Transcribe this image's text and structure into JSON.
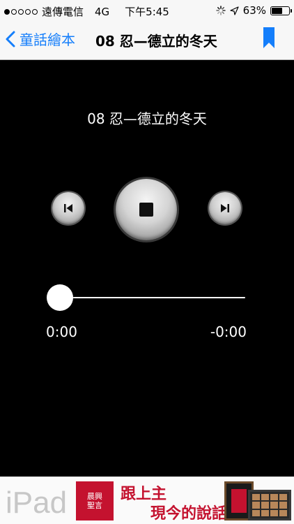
{
  "status_bar": {
    "carrier": "遠傳電信",
    "network": "4G",
    "time": "下午5:45",
    "battery_percent": "63%",
    "battery_level": 0.63,
    "signal_bars_filled": 1,
    "signal_bars_total": 5
  },
  "nav": {
    "back_label": "童話繪本",
    "title": "08 忍—德立的冬天",
    "accent_color": "#147efb"
  },
  "player": {
    "track_title": "08 忍—德立的冬天",
    "elapsed": "0:00",
    "remaining": "-0:00",
    "progress": 0,
    "state": "stop"
  },
  "ad": {
    "brand_text": "iPad",
    "logo_line1": "晨興",
    "logo_line2": "聖言",
    "headline_1": "跟上主",
    "headline_2": "現今的說話"
  }
}
